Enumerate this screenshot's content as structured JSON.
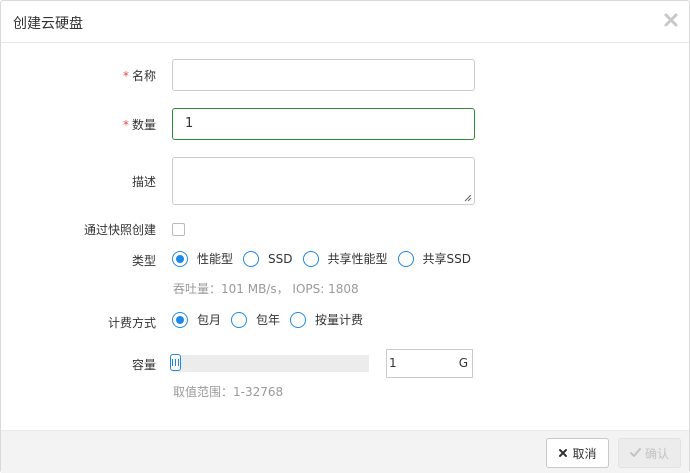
{
  "dialog": {
    "title": "创建云硬盘"
  },
  "fields": {
    "name": {
      "label": "名称",
      "required_mark": "*",
      "value": ""
    },
    "quantity": {
      "label": "数量",
      "required_mark": "*",
      "value": "1"
    },
    "description": {
      "label": "描述",
      "value": ""
    },
    "snapshot": {
      "label": "通过快照创建",
      "checked": false
    },
    "type": {
      "label": "类型",
      "options": [
        "性能型",
        "SSD",
        "共享性能型",
        "共享SSD"
      ],
      "selected": "性能型",
      "hint": "吞吐量：101 MB/s， IOPS: 1808"
    },
    "billing": {
      "label": "计费方式",
      "options": [
        "包月",
        "包年",
        "按量计费"
      ],
      "selected": "包月"
    },
    "capacity": {
      "label": "容量",
      "value": "1",
      "unit": "G",
      "range_hint": "取值范围：1-32768",
      "slider_fraction": 0.0
    }
  },
  "footer": {
    "cancel_label": "取消",
    "ok_label": "确认"
  },
  "colors": {
    "accent": "#1e88e5",
    "focus_border": "#2f8a37",
    "required": "#e14c4c"
  }
}
